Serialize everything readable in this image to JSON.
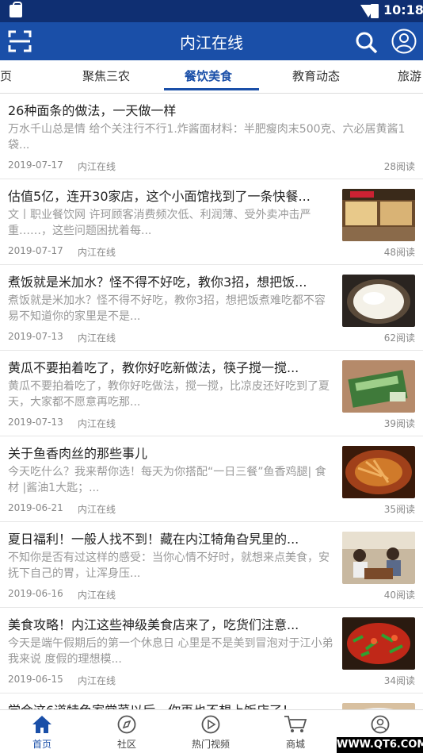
{
  "status": {
    "time": "10:18"
  },
  "app": {
    "title": "内江在线"
  },
  "tabs": [
    {
      "label": "页"
    },
    {
      "label": "聚焦三农"
    },
    {
      "label": "餐饮美食"
    },
    {
      "label": "教育动态"
    },
    {
      "label": "旅游"
    }
  ],
  "articles": [
    {
      "title": "26种面条的做法，一天做一样",
      "desc": "万水千山总是情 给个关注行不行1.炸酱面材料：半肥瘦肉末500克、六必居黄酱1袋...",
      "date": "2019-07-17",
      "source": "内江在线",
      "reads": "28阅读"
    },
    {
      "title": "估值5亿，连开30家店，这个小面馆找到了一条快餐...",
      "desc": "文丨职业餐饮网 许珂顾客消费频次低、利润薄、受外卖冲击严重……，这些问题困扰着每...",
      "date": "2019-07-17",
      "source": "内江在线",
      "reads": "48阅读"
    },
    {
      "title": "煮饭就是米加水？怪不得不好吃，教你3招，想把饭...",
      "desc": "煮饭就是米加水？怪不得不好吃，教你3招，想把饭煮难吃都不容易不知道你的家里是不是...",
      "date": "2019-07-13",
      "source": "内江在线",
      "reads": "62阅读"
    },
    {
      "title": "黄瓜不要拍着吃了，教你好吃新做法，筷子搅一搅...",
      "desc": "黄瓜不要拍着吃了，教你好吃做法，搅一搅，比凉皮还好吃到了夏天，大家都不愿意再吃那...",
      "date": "2019-07-13",
      "source": "内江在线",
      "reads": "39阅读"
    },
    {
      "title": "关于鱼香肉丝的那些事儿",
      "desc": "今天吃什么？我来帮你选！每天为你搭配“一日三餐”鱼香鸡腿| 食材 |酱油1大匙；...",
      "date": "2019-06-21",
      "source": "内江在线",
      "reads": "35阅读"
    },
    {
      "title": "夏日福利！一般人找不到！藏在内江犄角旮旯里的...",
      "desc": "不知你是否有过这样的感受：当你心情不好时，就想来点美食，安抚下自己的胃，让浑身压...",
      "date": "2019-06-16",
      "source": "内江在线",
      "reads": "40阅读"
    },
    {
      "title": "美食攻略！内江这些神级美食店来了，吃货们注意...",
      "desc": "今天是端午假期后的第一个休息日 心里是不是美到冒泡对于江小弟我来说 度假的理想模...",
      "date": "2019-06-15",
      "source": "内江在线",
      "reads": "34阅读"
    },
    {
      "title": "学会这6道特色家常菜以后，你再也不想上饭店了！",
      "desc": "",
      "date": "",
      "source": "",
      "reads": ""
    }
  ],
  "nav": [
    {
      "label": "首页"
    },
    {
      "label": "社区"
    },
    {
      "label": "热门视频"
    },
    {
      "label": "商城"
    },
    {
      "label": ""
    }
  ],
  "watermark": "WWW.QT6.COM",
  "colors": {
    "primary": "#1a4fa8",
    "statusbar": "#0f2f72"
  }
}
